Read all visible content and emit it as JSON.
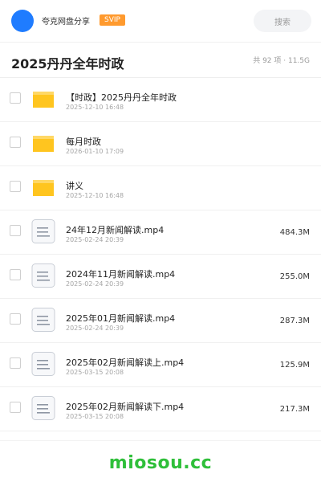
{
  "header": {
    "user_name": "夸克网盘分享",
    "badge": "SVIP",
    "search_placeholder": "搜索"
  },
  "folder": {
    "title": "2025丹丹全年时政",
    "summary": "共 92 项 · 11.5G"
  },
  "items": [
    {
      "type": "folder",
      "icon": "folder-icon",
      "name": "【时政】2025丹丹全年时政",
      "date": "2025-12-10 16:48",
      "size": ""
    },
    {
      "type": "folder",
      "icon": "folder-icon",
      "name": "每月时政",
      "date": "2026-01-10 17:09",
      "size": ""
    },
    {
      "type": "folder",
      "icon": "folder-icon",
      "name": "讲义",
      "date": "2025-12-10 16:48",
      "size": ""
    },
    {
      "type": "file",
      "icon": "video-file-icon",
      "name": "24年12月新闻解读.mp4",
      "date": "2025-02-24 20:39",
      "size": "484.3M"
    },
    {
      "type": "file",
      "icon": "video-file-icon",
      "name": "2024年11月新闻解读.mp4",
      "date": "2025-02-24 20:39",
      "size": "255.0M"
    },
    {
      "type": "file",
      "icon": "video-file-icon",
      "name": "2025年01月新闻解读.mp4",
      "date": "2025-02-24 20:39",
      "size": "287.3M"
    },
    {
      "type": "file",
      "icon": "video-file-icon",
      "name": "2025年02月新闻解读上.mp4",
      "date": "2025-03-15 20:08",
      "size": "125.9M"
    },
    {
      "type": "file",
      "icon": "video-file-icon",
      "name": "2025年02月新闻解读下.mp4",
      "date": "2025-03-15 20:08",
      "size": "217.3M"
    }
  ],
  "watermark": "miosou.cc",
  "colors": {
    "avatar": "#1f7cff",
    "badge": "#ff9a2e",
    "folder": "#ffc51f",
    "watermark": "#2fbf3a"
  }
}
